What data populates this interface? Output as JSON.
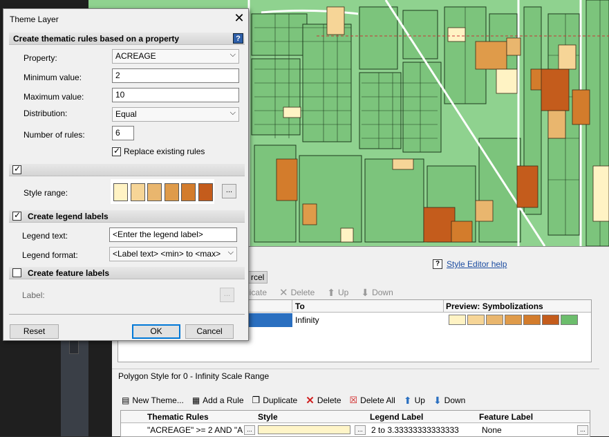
{
  "dialog": {
    "title": "Theme Layer",
    "section_property": "Create thematic rules based on a property",
    "property_label": "Property:",
    "property_value": "ACREAGE",
    "min_label": "Minimum value:",
    "min_value": "2",
    "max_label": "Maximum value:",
    "max_value": "10",
    "distribution_label": "Distribution:",
    "distribution_value": "Equal",
    "num_rules_label": "Number of rules:",
    "num_rules_value": "6",
    "replace_label": "Replace existing rules",
    "replace_checked": true,
    "style_section_checked": true,
    "style_range_label": "Style range:",
    "style_range_colors": [
      "#fff3c4",
      "#f6d597",
      "#e9b66e",
      "#df9b4a",
      "#d37c2c",
      "#c45c1c"
    ],
    "legend_section": "Create legend labels",
    "legend_checked": true,
    "legend_text_label": "Legend text:",
    "legend_text_placeholder": "<Enter the legend label>",
    "legend_format_label": "Legend format:",
    "legend_format_value": "<Label text> <min> to <max>",
    "feature_section": "Create feature labels",
    "feature_checked": false,
    "label_label": "Label:",
    "ellipsis": "...",
    "reset": "Reset",
    "ok": "OK",
    "cancel": "Cancel"
  },
  "style_editor": {
    "help_link": "Style Editor help",
    "help_q": "?",
    "parcel_tab": "rcel",
    "toolbar1": [
      {
        "icon": "duplicate-icon",
        "label": "licate"
      },
      {
        "icon": "delete-icon",
        "label": "Delete"
      },
      {
        "icon": "up-arrow-icon",
        "label": "Up"
      },
      {
        "icon": "down-arrow-icon",
        "label": "Down"
      }
    ],
    "grid1_headers": {
      "to": "To",
      "preview": "Preview: Symbolizations"
    },
    "grid1_row": {
      "to": "Infinity"
    },
    "preview_colors": [
      "#fff3c4",
      "#f6d597",
      "#e9b66e",
      "#df9b4a",
      "#d37c2c",
      "#c45c1c",
      "#6cbd6c"
    ],
    "polygon_header": "Polygon Style for 0 - Infinity Scale Range",
    "toolbar2": [
      {
        "icon": "new-theme-icon",
        "label": "New Theme..."
      },
      {
        "icon": "add-rule-icon",
        "label": "Add a Rule"
      },
      {
        "icon": "duplicate-icon",
        "label": "Duplicate"
      },
      {
        "icon": "delete-icon",
        "label": "Delete"
      },
      {
        "icon": "delete-all-icon",
        "label": "Delete All"
      },
      {
        "icon": "up-arrow-icon",
        "label": "Up"
      },
      {
        "icon": "down-arrow-icon",
        "label": "Down"
      }
    ],
    "grid2_headers": {
      "rules": "Thematic Rules",
      "style": "Style",
      "legend": "Legend Label",
      "feature": "Feature Label"
    },
    "grid2_row": {
      "rule": "\"ACREAGE\" >= 2 AND \"A",
      "legend": "2 to 3.33333333333333",
      "feature": "None"
    }
  },
  "map": {
    "title": "..."
  }
}
